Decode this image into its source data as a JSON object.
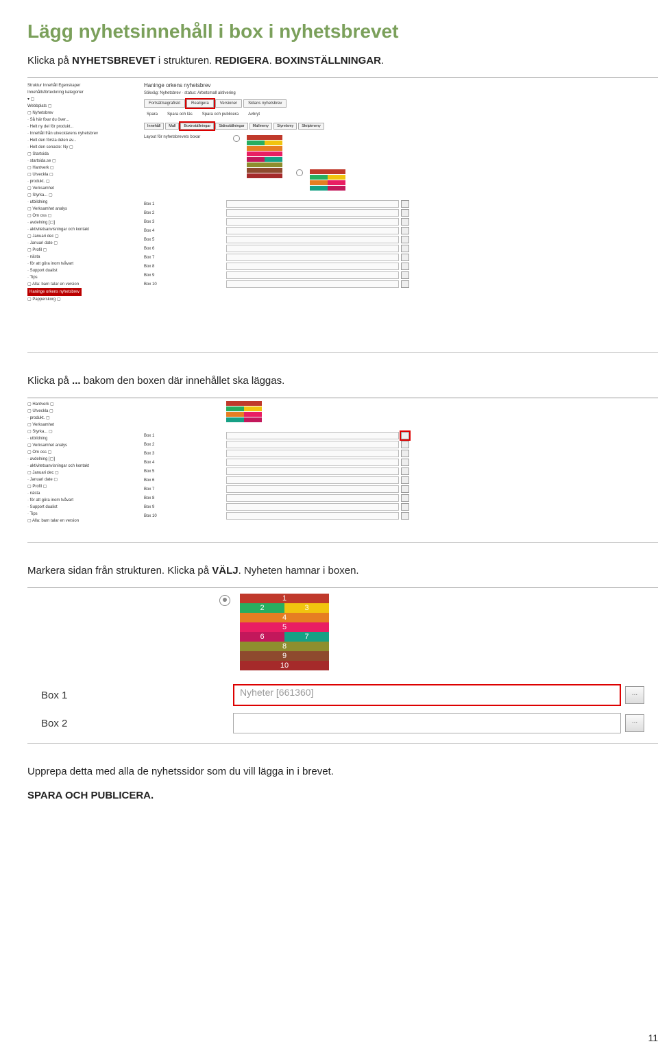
{
  "heading": "Lägg nyhetsinnehåll i box i nyhetsbrevet",
  "para1_a": "Klicka på ",
  "para1_b": "NYHETSBREVET",
  "para1_c": " i strukturen. ",
  "para1_d": "REDIGERA",
  "para1_e": ". ",
  "para1_f": "BOXINSTÄLLNINGAR",
  "para1_g": ".",
  "para2_a": "Klicka på ",
  "para2_b": "...",
  "para2_c": " bakom den boxen där innehållet ska läggas.",
  "para3_a": "Markera sidan från strukturen. Klicka på ",
  "para3_b": "VÄLJ",
  "para3_c": ". Nyheten hamnar i boxen.",
  "para4": "Upprepa detta med alla de nyhetssidor som du vill lägga in i brevet.",
  "para5": "SPARA OCH PUBLICERA.",
  "page_number": "11",
  "ss1": {
    "tree_items": [
      "Struktur  Innehåll  Egenskaper",
      "Innehållsförteckning   kategorier",
      "▾  ▢",
      "Webbplats ▢",
      "▢ Nyhetsbrev",
      "  · Så här fixar du över...",
      "  · Helt ny del för produkt...",
      "  · Innehåll från utvecklarens nyhetsbrev",
      "  · Helt den första delen av...",
      "  · Helt den senaste: Ny ▢",
      "▢ Startsida",
      "  · startsida.se  ▢",
      "▢ Hantverk  ▢",
      "▢ Utveckla  ▢",
      "  · produkt. ▢",
      "▢ Verksamhet",
      "▢ Styrka...  ▢",
      "  · utbildning",
      "▢ Verksamhet analys",
      "▢ Om oss  ▢",
      "  · avdelning [▢]",
      "· aktivitetsanvisningar och kontakt",
      "▢ Januari dec  ▢",
      "  · Januari date  ▢",
      "▢ Profil  ▢",
      "  · nästa",
      "  · för att göra inom tvåvart",
      "  · Support dualist",
      "  · Tips",
      "▢ Alla: barn talar en version",
      "",
      "▢  Papperskorg ▢"
    ],
    "highlight_tree": "Haninge orkens nyhetsbrev",
    "main_title": "Haninge orkens nyhetsbrev",
    "main_sub": "Sökväg:  Nyhetsbrev · status:  Arbetsmall aktivering",
    "tabs": [
      "Fortsättsegrafiskt",
      "Realigera",
      "Versioner",
      "Sidans nyhetsbrev"
    ],
    "btns": [
      "Spara",
      "Spara och läs",
      "Spara och publicera",
      "Avbryt"
    ],
    "small_tabs": [
      "Innehåll",
      "Mall",
      "Boxinställningar",
      "Sidinställningar",
      "Mallmeny",
      "Styrelsmy",
      "Skriptmeny"
    ],
    "layout_label": "Layout för nyhetsbrevets boxar",
    "boxes": [
      "Box 1",
      "Box 2",
      "Box 3",
      "Box 4",
      "Box 5",
      "Box 6",
      "Box 7",
      "Box 8",
      "Box 9",
      "Box 10"
    ]
  },
  "ss3": {
    "numbers": [
      "1",
      "2",
      "3",
      "4",
      "5",
      "6",
      "7",
      "8",
      "9",
      "10"
    ],
    "row1_label": "Box 1",
    "row1_value": "Nyheter [661360]",
    "row2_label": "Box 2",
    "btn_label": "..."
  }
}
